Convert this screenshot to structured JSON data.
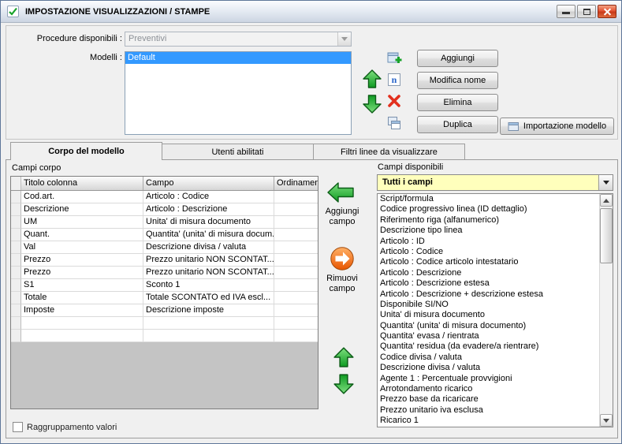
{
  "window": {
    "title": "IMPOSTAZIONE VISUALIZZAZIONI / STAMPE"
  },
  "colors": {
    "selection_blue": "#3399ff",
    "combo_yellow": "#ffffbc",
    "arrow_green": "#12a326",
    "remove_orange": "#ee5a00",
    "delete_red": "#e2301e"
  },
  "icons": {
    "rename_glyph": "n"
  },
  "top": {
    "procedure_label": "Procedure disponibili :",
    "procedure_value": "Preventivi",
    "modelli_label": "Modelli :",
    "modelli_items": [
      "Default"
    ],
    "modelli_selected_index": 0,
    "buttons": {
      "aggiungi": "Aggiungi",
      "modifica_nome": "Modifica nome",
      "elimina": "Elimina",
      "duplica": "Duplica",
      "importazione_modello": "Importazione modello"
    }
  },
  "tabs": [
    {
      "label": "Corpo del modello",
      "active": true
    },
    {
      "label": "Utenti abilitati",
      "active": false
    },
    {
      "label": "Filtri linee da visualizzare",
      "active": false
    }
  ],
  "body": {
    "campi_corpo_label": "Campi corpo",
    "table": {
      "headers": [
        "Titolo colonna",
        "Campo",
        "Ordinamento"
      ],
      "rows": [
        [
          "Cod.art.",
          "Articolo : Codice",
          ""
        ],
        [
          "Descrizione",
          "Articolo : Descrizione",
          ""
        ],
        [
          "UM",
          "Unita' di misura documento",
          ""
        ],
        [
          "Quant.",
          "Quantita' (unita' di misura docum...",
          ""
        ],
        [
          "Val",
          "Descrizione divisa / valuta",
          ""
        ],
        [
          "Prezzo",
          "Prezzo unitario NON SCONTAT...",
          ""
        ],
        [
          "Prezzo",
          "Prezzo unitario NON SCONTAT...",
          ""
        ],
        [
          "S1",
          "Sconto 1",
          ""
        ],
        [
          "Totale",
          "Totale SCONTATO ed IVA escl...",
          ""
        ],
        [
          "Imposte",
          "Descrizione imposte",
          ""
        ]
      ]
    },
    "transfer": {
      "aggiungi_campo": "Aggiungi campo",
      "rimuovi_campo": "Rimuovi campo"
    },
    "campi_disponibili_label": "Campi disponibili",
    "fields_filter_value": "Tutti i campi",
    "available_fields": [
      "Script/formula",
      "Codice progressivo linea (ID dettaglio)",
      "Riferimento riga (alfanumerico)",
      "Descrizione tipo linea",
      "Articolo : ID",
      "Articolo : Codice",
      "Articolo : Codice articolo intestatario",
      "Articolo : Descrizione",
      "Articolo : Descrizione estesa",
      "Articolo : Descrizione + descrizione estesa",
      "Disponibile SI/NO",
      "Unita' di misura documento",
      "Quantita' (unita' di misura documento)",
      "Quantita' evasa / rientrata",
      "Quantita' residua (da evadere/a rientrare)",
      "Codice divisa / valuta",
      "Descrizione divisa / valuta",
      "Agente 1 : Percentuale provvigioni",
      "Arrotondamento ricarico",
      "Prezzo base da ricaricare",
      "Prezzo unitario iva esclusa",
      "Ricarico 1"
    ],
    "raggruppamento_label": "Raggruppamento valori"
  }
}
